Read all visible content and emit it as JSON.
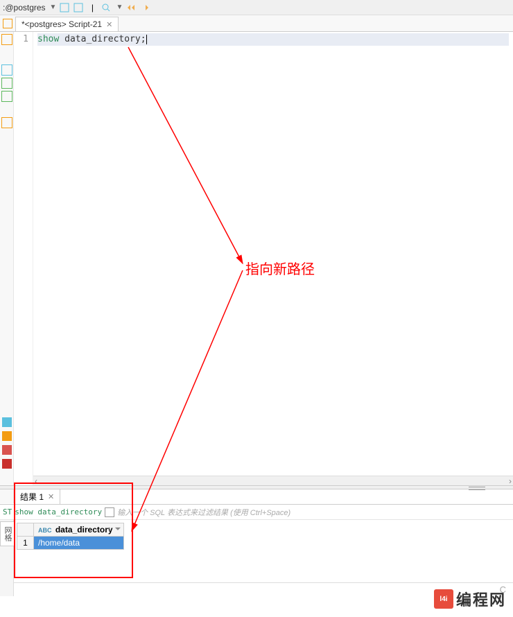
{
  "toolbar": {
    "db_label": ":@postgres",
    "dropdown_glyph": "▼"
  },
  "tab": {
    "title": "*<postgres> Script-21",
    "close_glyph": "✕"
  },
  "editor": {
    "line_number": "1",
    "code_keyword": "show",
    "code_ident": " data_directory;"
  },
  "results": {
    "tab_label": "结果 1",
    "tab_close": "✕",
    "sql_badge": "ST",
    "sql_text": "show data_directory",
    "filter_placeholder": "输入一个 SQL 表达式来过滤结果 (使用 Ctrl+Space)",
    "side_tab": "网格",
    "column_type": "ABC",
    "column_name": "data_directory",
    "filter_icon": "⏷",
    "sort_icon": "↕",
    "row_number": "1",
    "cell_value": "/home/data",
    "footer_status": "C"
  },
  "annotation": {
    "label": "指向新路径"
  },
  "watermark": {
    "logo_text": "l4i",
    "brand": "编程网"
  }
}
